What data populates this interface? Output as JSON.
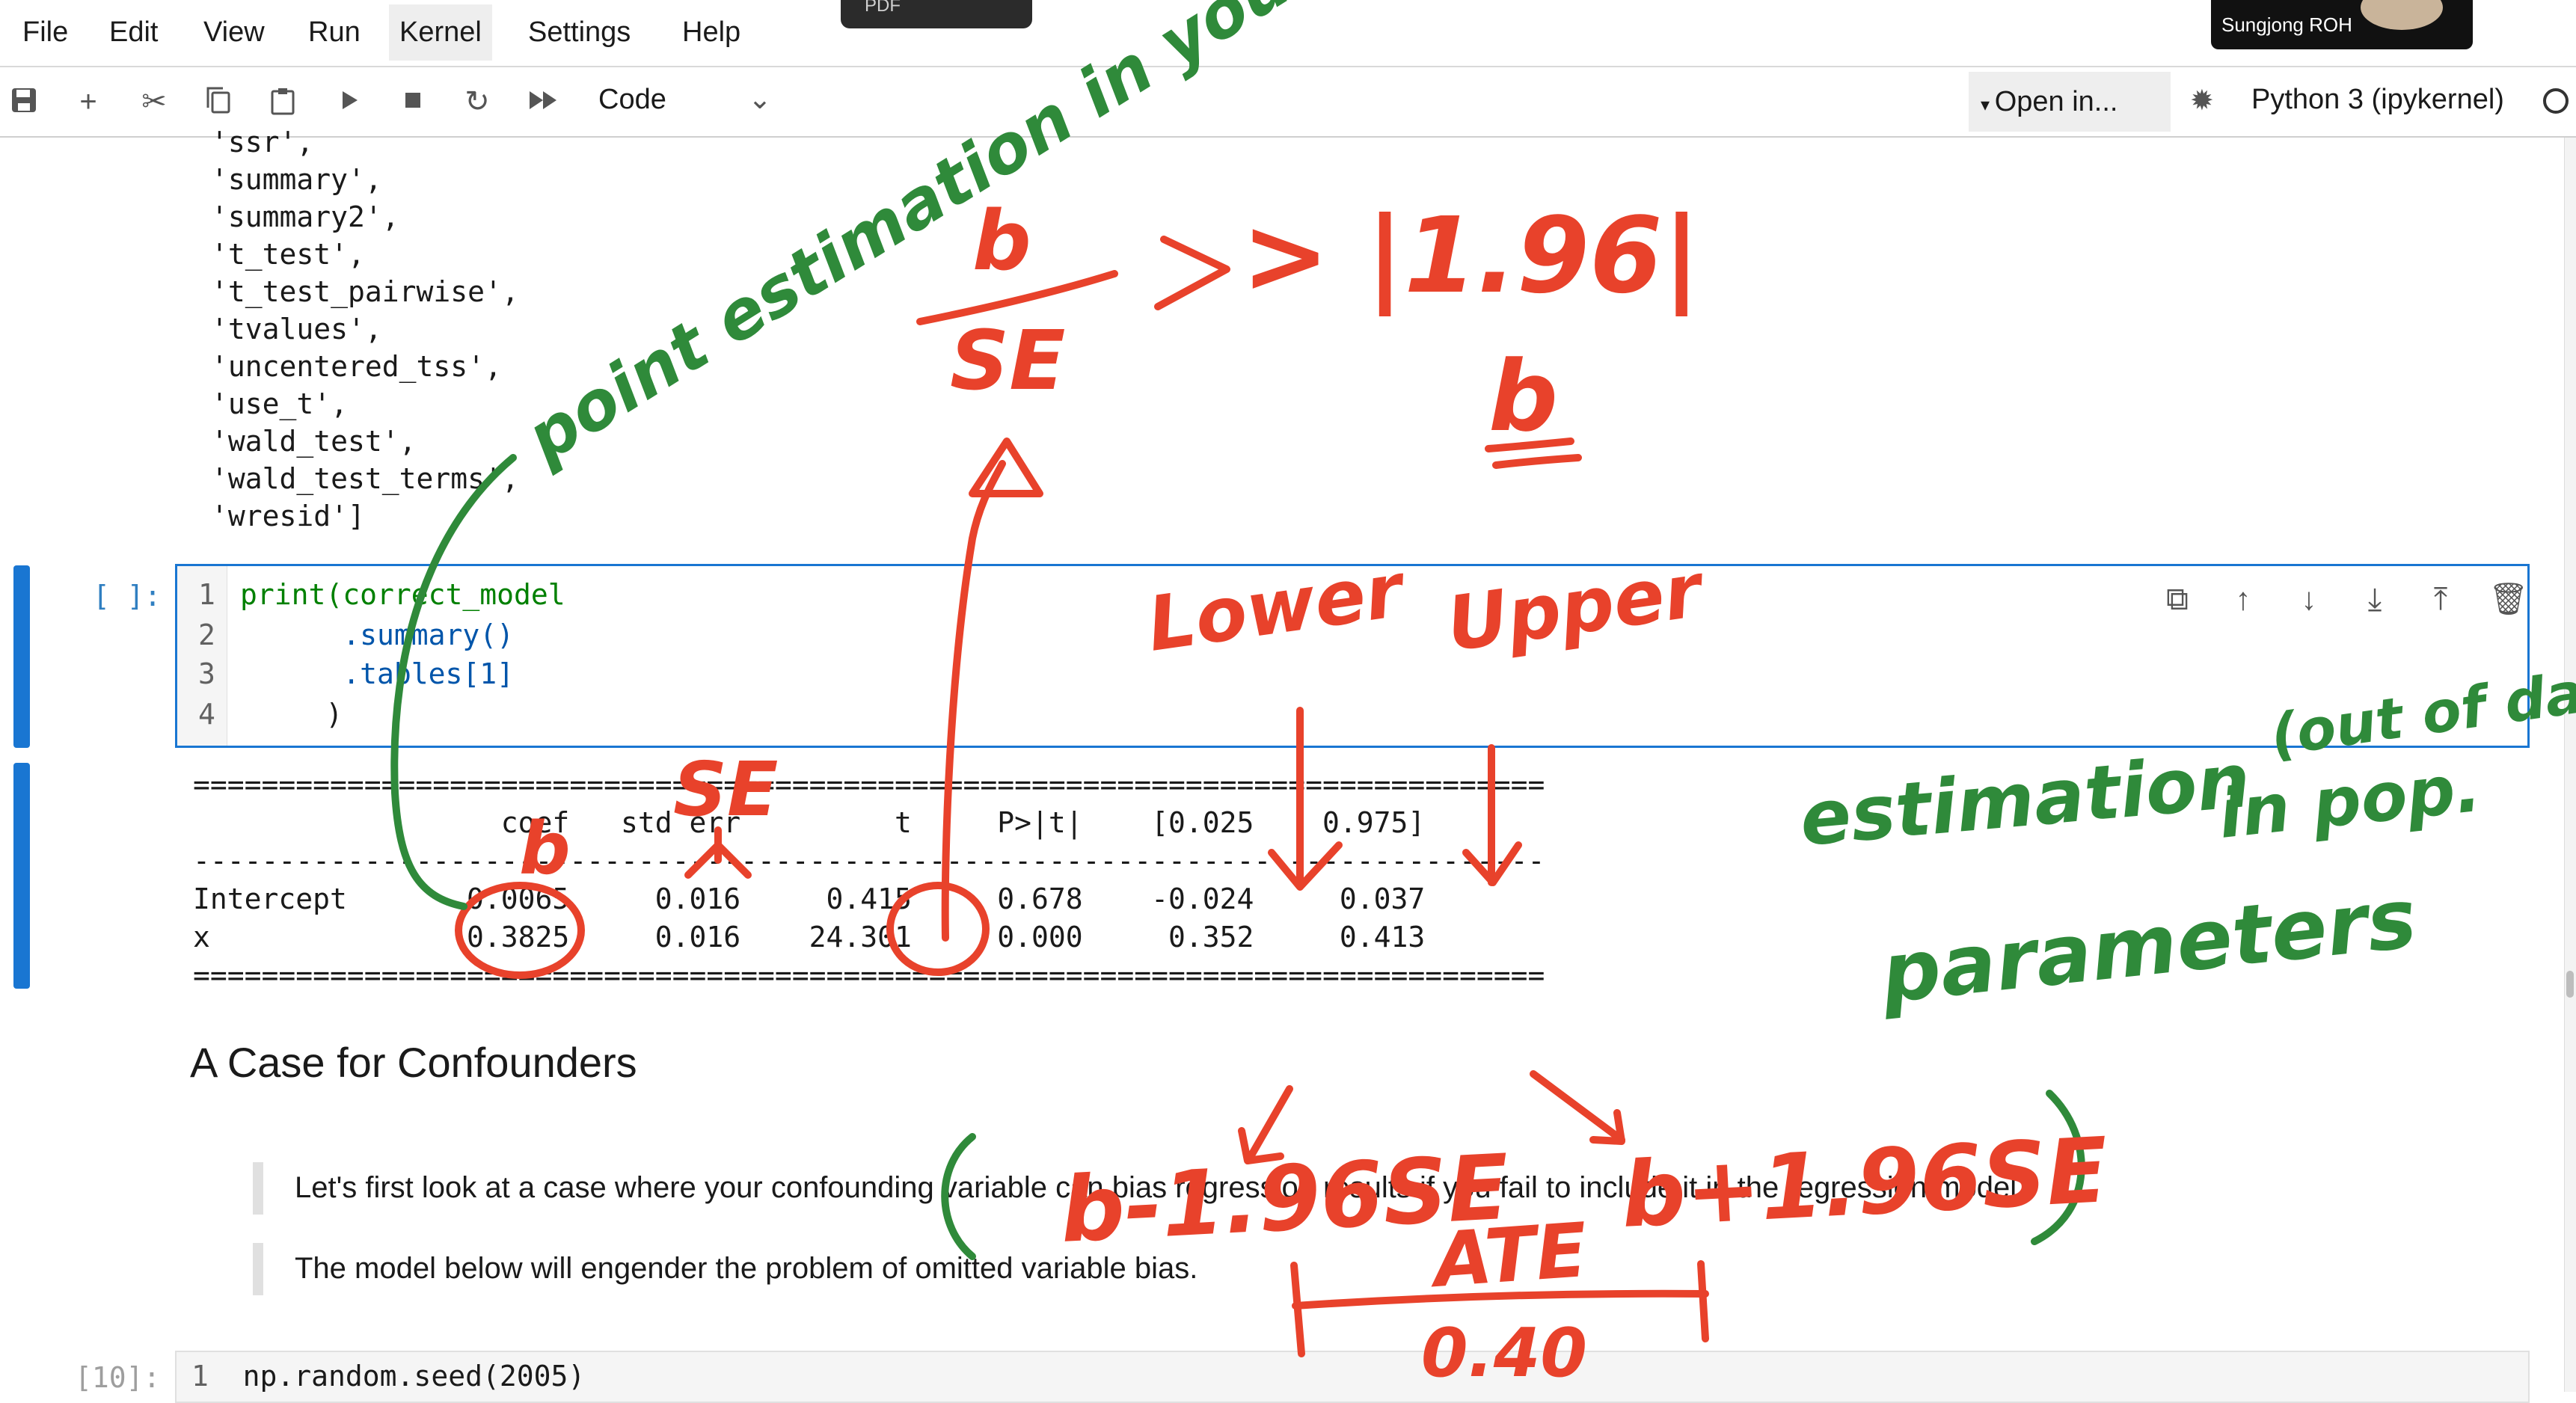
{
  "menubar": {
    "items": [
      "File",
      "Edit",
      "View",
      "Run",
      "Kernel",
      "Settings",
      "Help"
    ],
    "active": "Kernel",
    "pdf_tab": "PDF",
    "participant_name": "Sungjong ROH"
  },
  "toolbar": {
    "cell_type": "Code",
    "open_in": "Open in...",
    "kernel": "Python 3 (ipykernel)",
    "icons": [
      "save-icon",
      "add-cell-icon",
      "cut-icon",
      "copy-icon",
      "paste-icon",
      "run-icon",
      "stop-icon",
      "restart-icon",
      "run-all-icon",
      "chevron-down-icon",
      "bug-icon"
    ]
  },
  "previous_output": {
    "lines": [
      "'ssr',",
      "'summary',",
      "'summary2',",
      "'t_test',",
      "'t_test_pairwise',",
      "'tvalues',",
      "'uncentered_tss',",
      "'use_t',",
      "'wald_test',",
      "'wald_test_terms',",
      "'wresid']"
    ]
  },
  "code_cell": {
    "prompt": "[ ]:",
    "lines": [
      {
        "n": "1",
        "text": "print(correct_model"
      },
      {
        "n": "2",
        "text": "      .summary()"
      },
      {
        "n": "3",
        "text": "      .tables[1]"
      },
      {
        "n": "4",
        "text": "     )"
      }
    ],
    "tools": [
      "duplicate-icon",
      "move-up-icon",
      "move-down-icon",
      "insert-below-icon",
      "insert-above-icon",
      "delete-icon"
    ]
  },
  "regression_table": {
    "rule": "===============================================================================",
    "dash_rule": "-------------------------------------------------------------------------------",
    "header": [
      "",
      "coef",
      "std err",
      "t",
      "P>|t|",
      "[0.025",
      "0.975]"
    ],
    "rows": [
      [
        "Intercept",
        "0.0065",
        "0.016",
        "0.415",
        "0.678",
        "-0.024",
        "0.037"
      ],
      [
        "x",
        "0.3825",
        "0.016",
        "24.301",
        "0.000",
        "0.352",
        "0.413"
      ]
    ]
  },
  "markdown": {
    "heading": "A Case for Confounders",
    "quote1": "Let's first look at a case where your confounding variable can bias regression results if you fail to include it in the regression model.",
    "quote2": "The model below will engender the problem of omitted variable bias."
  },
  "next_cell": {
    "prompt": "[10]:",
    "line_number": "1",
    "code": "np.random.seed(2005)"
  },
  "annotations": {
    "fraction_num": "b",
    "fraction_den": "SE",
    "threshold": "> |1.96|",
    "b_underlined": "b",
    "point_estimation": "point estimation in your data",
    "lower": "Lower",
    "upper": "Upper",
    "se_label": "SE",
    "b_label": "b",
    "estimation": "estimation",
    "out_of_data": "(out of data)",
    "in_pop": "in pop.",
    "parameters": "parameters",
    "ci_lower": "b-1.96SE",
    "ci_upper": "b+1.96SE",
    "ate": "ATE",
    "ate_value": "0.40",
    "colors": {
      "red": "#e8422b",
      "green": "#2f8a3a"
    }
  }
}
